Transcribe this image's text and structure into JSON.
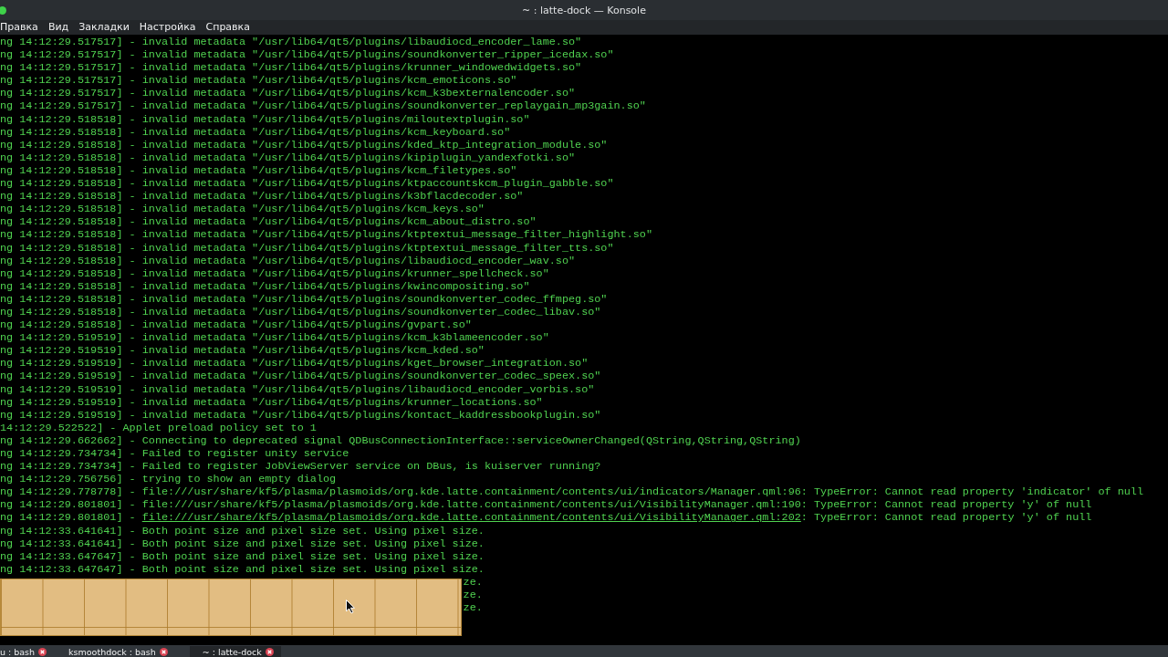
{
  "window": {
    "title": "~ : latte-dock — Konsole"
  },
  "menu": [
    "Правка",
    "Вид",
    "Закладки",
    "Настройка",
    "Справка"
  ],
  "log": [
    {
      "kind": "plain",
      "text": "ng 14:12:29.517517] - invalid metadata \"/usr/lib64/qt5/plugins/libaudiocd_encoder_lame.so\""
    },
    {
      "kind": "plain",
      "text": "ng 14:12:29.517517] - invalid metadata \"/usr/lib64/qt5/plugins/soundkonverter_ripper_icedax.so\""
    },
    {
      "kind": "plain",
      "text": "ng 14:12:29.517517] - invalid metadata \"/usr/lib64/qt5/plugins/krunner_windowedwidgets.so\""
    },
    {
      "kind": "plain",
      "text": "ng 14:12:29.517517] - invalid metadata \"/usr/lib64/qt5/plugins/kcm_emoticons.so\""
    },
    {
      "kind": "plain",
      "text": "ng 14:12:29.517517] - invalid metadata \"/usr/lib64/qt5/plugins/kcm_k3bexternalencoder.so\""
    },
    {
      "kind": "plain",
      "text": "ng 14:12:29.517517] - invalid metadata \"/usr/lib64/qt5/plugins/soundkonverter_replaygain_mp3gain.so\""
    },
    {
      "kind": "plain",
      "text": "ng 14:12:29.518518] - invalid metadata \"/usr/lib64/qt5/plugins/miloutextplugin.so\""
    },
    {
      "kind": "plain",
      "text": "ng 14:12:29.518518] - invalid metadata \"/usr/lib64/qt5/plugins/kcm_keyboard.so\""
    },
    {
      "kind": "plain",
      "text": "ng 14:12:29.518518] - invalid metadata \"/usr/lib64/qt5/plugins/kded_ktp_integration_module.so\""
    },
    {
      "kind": "plain",
      "text": "ng 14:12:29.518518] - invalid metadata \"/usr/lib64/qt5/plugins/kipiplugin_yandexfotki.so\""
    },
    {
      "kind": "plain",
      "text": "ng 14:12:29.518518] - invalid metadata \"/usr/lib64/qt5/plugins/kcm_filetypes.so\""
    },
    {
      "kind": "plain",
      "text": "ng 14:12:29.518518] - invalid metadata \"/usr/lib64/qt5/plugins/ktpaccountskcm_plugin_gabble.so\""
    },
    {
      "kind": "plain",
      "text": "ng 14:12:29.518518] - invalid metadata \"/usr/lib64/qt5/plugins/k3bflacdecoder.so\""
    },
    {
      "kind": "plain",
      "text": "ng 14:12:29.518518] - invalid metadata \"/usr/lib64/qt5/plugins/kcm_keys.so\""
    },
    {
      "kind": "plain",
      "text": "ng 14:12:29.518518] - invalid metadata \"/usr/lib64/qt5/plugins/kcm_about_distro.so\""
    },
    {
      "kind": "plain",
      "text": "ng 14:12:29.518518] - invalid metadata \"/usr/lib64/qt5/plugins/ktptextui_message_filter_highlight.so\""
    },
    {
      "kind": "plain",
      "text": "ng 14:12:29.518518] - invalid metadata \"/usr/lib64/qt5/plugins/ktptextui_message_filter_tts.so\""
    },
    {
      "kind": "plain",
      "text": "ng 14:12:29.518518] - invalid metadata \"/usr/lib64/qt5/plugins/libaudiocd_encoder_wav.so\""
    },
    {
      "kind": "plain",
      "text": "ng 14:12:29.518518] - invalid metadata \"/usr/lib64/qt5/plugins/krunner_spellcheck.so\""
    },
    {
      "kind": "plain",
      "text": "ng 14:12:29.518518] - invalid metadata \"/usr/lib64/qt5/plugins/kwincompositing.so\""
    },
    {
      "kind": "plain",
      "text": "ng 14:12:29.518518] - invalid metadata \"/usr/lib64/qt5/plugins/soundkonverter_codec_ffmpeg.so\""
    },
    {
      "kind": "plain",
      "text": "ng 14:12:29.518518] - invalid metadata \"/usr/lib64/qt5/plugins/soundkonverter_codec_libav.so\""
    },
    {
      "kind": "plain",
      "text": "ng 14:12:29.518518] - invalid metadata \"/usr/lib64/qt5/plugins/gvpart.so\""
    },
    {
      "kind": "plain",
      "text": "ng 14:12:29.519519] - invalid metadata \"/usr/lib64/qt5/plugins/kcm_k3blameencoder.so\""
    },
    {
      "kind": "plain",
      "text": "ng 14:12:29.519519] - invalid metadata \"/usr/lib64/qt5/plugins/kcm_kded.so\""
    },
    {
      "kind": "plain",
      "text": "ng 14:12:29.519519] - invalid metadata \"/usr/lib64/qt5/plugins/kget_browser_integration.so\""
    },
    {
      "kind": "plain",
      "text": "ng 14:12:29.519519] - invalid metadata \"/usr/lib64/qt5/plugins/soundkonverter_codec_speex.so\""
    },
    {
      "kind": "plain",
      "text": "ng 14:12:29.519519] - invalid metadata \"/usr/lib64/qt5/plugins/libaudiocd_encoder_vorbis.so\""
    },
    {
      "kind": "plain",
      "text": "ng 14:12:29.519519] - invalid metadata \"/usr/lib64/qt5/plugins/krunner_locations.so\""
    },
    {
      "kind": "plain",
      "text": "ng 14:12:29.519519] - invalid metadata \"/usr/lib64/qt5/plugins/kontact_kaddressbookplugin.so\""
    },
    {
      "kind": "plain",
      "text": "14:12:29.522522] - Applet preload policy set to 1"
    },
    {
      "kind": "plain",
      "text": "ng 14:12:29.662662] - Connecting to deprecated signal QDBusConnectionInterface::serviceOwnerChanged(QString,QString,QString)"
    },
    {
      "kind": "plain",
      "text": "ng 14:12:29.734734] - Failed to register unity service"
    },
    {
      "kind": "plain",
      "text": "ng 14:12:29.734734] - Failed to register JobViewServer service on DBus, is kuiserver running?"
    },
    {
      "kind": "plain",
      "text": "ng 14:12:29.756756] - trying to show an empty dialog"
    },
    {
      "kind": "plain",
      "text": "ng 14:12:29.778778] - file:///usr/share/kf5/plasma/plasmoids/org.kde.latte.containment/contents/ui/indicators/Manager.qml:96: TypeError: Cannot read property 'indicator' of null"
    },
    {
      "kind": "plain",
      "text": "ng 14:12:29.801801] - file:///usr/share/kf5/plasma/plasmoids/org.kde.latte.containment/contents/ui/VisibilityManager.qml:190: TypeError: Cannot read property 'y' of null"
    },
    {
      "kind": "link",
      "before": "ng 14:12:29.801801] - ",
      "link": "file:///usr/share/kf5/plasma/plasmoids/org.kde.latte.containment/contents/ui/VisibilityManager.qml:202",
      "after": ": TypeError: Cannot read property 'y' of null"
    },
    {
      "kind": "plain",
      "text": "ng 14:12:33.641641] - Both point size and pixel size set. Using pixel size."
    },
    {
      "kind": "plain",
      "text": "ng 14:12:33.641641] - Both point size and pixel size set. Using pixel size."
    },
    {
      "kind": "plain",
      "text": "ng 14:12:33.647647] - Both point size and pixel size set. Using pixel size."
    },
    {
      "kind": "plain",
      "text": "ng 14:12:33.647647] - Both point size and pixel size set. Using pixel size."
    },
    {
      "kind": "tail",
      "text": "ze."
    },
    {
      "kind": "tail",
      "text": "ze."
    },
    {
      "kind": "tail",
      "text": "ze."
    }
  ],
  "tabs": [
    {
      "label": "u : bash",
      "selected": false
    },
    {
      "label": "ksmoothdock : bash",
      "selected": false
    },
    {
      "label": "~ : latte-dock",
      "selected": true
    }
  ]
}
